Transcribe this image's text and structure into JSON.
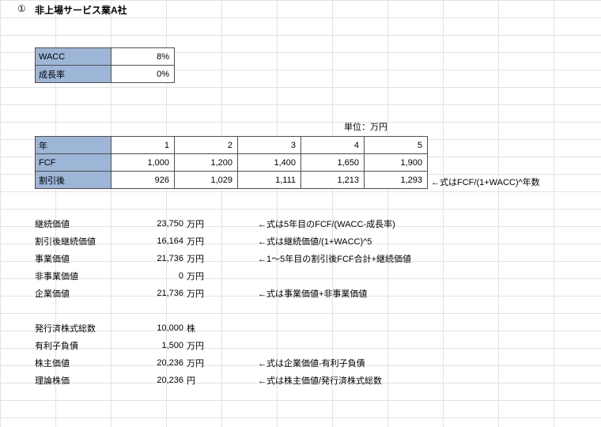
{
  "header": {
    "marker": "①",
    "title": "非上場サービス業A社"
  },
  "assumptions": {
    "wacc_label": "WACC",
    "wacc_value": "8%",
    "growth_label": "成長率",
    "growth_value": "0%"
  },
  "units_label": "単位：万円",
  "projection": {
    "year_label": "年",
    "fcf_label": "FCF",
    "disc_label": "割引後",
    "years": [
      "1",
      "2",
      "3",
      "4",
      "5"
    ],
    "fcf": [
      "1,000",
      "1,200",
      "1,400",
      "1,650",
      "1,900"
    ],
    "disc": [
      "926",
      "1,029",
      "1,111",
      "1,213",
      "1,293"
    ],
    "disc_note": "←式はFCF/(1+WACC)^年数"
  },
  "summary": [
    {
      "label": "継続価値",
      "value": "23,750",
      "unit": "万円",
      "note": "←式は5年目のFCF/(WACC-成長率)"
    },
    {
      "label": "割引後継続価値",
      "value": "16,164",
      "unit": "万円",
      "note": "←式は継続価値/(1+WACC)^5"
    },
    {
      "label": "事業価値",
      "value": "21,736",
      "unit": "万円",
      "note": "←1〜5年目の割引後FCF合計+継続価値"
    },
    {
      "label": "非事業価値",
      "value": "0",
      "unit": "万円",
      "note": ""
    },
    {
      "label": "企業価値",
      "value": "21,736",
      "unit": "万円",
      "note": "←式は事業価値+非事業価値"
    },
    {
      "label": "",
      "value": "",
      "unit": "",
      "note": ""
    },
    {
      "label": "発行済株式総数",
      "value": "10,000",
      "unit": "株",
      "note": ""
    },
    {
      "label": "有利子負債",
      "value": "1,500",
      "unit": "万円",
      "note": ""
    },
    {
      "label": "株主価値",
      "value": "20,236",
      "unit": "万円",
      "note": "←式は企業価値-有利子負債"
    },
    {
      "label": "理論株価",
      "value": "20,236",
      "unit": "円",
      "note": "←式は株主価値/発行済株式総数"
    }
  ],
  "chart_data": {
    "type": "table",
    "title": "非上場サービス業A社 DCF法による企業価値評価",
    "assumptions": {
      "WACC": 0.08,
      "成長率": 0.0
    },
    "unit": "万円",
    "years": [
      1,
      2,
      3,
      4,
      5
    ],
    "FCF": [
      1000,
      1200,
      1400,
      1650,
      1900
    ],
    "割引後FCF": [
      926,
      1029,
      1111,
      1213,
      1293
    ],
    "継続価値_万円": 23750,
    "割引後継続価値_万円": 16164,
    "事業価値_万円": 21736,
    "非事業価値_万円": 0,
    "企業価値_万円": 21736,
    "発行済株式総数_株": 10000,
    "有利子負債_万円": 1500,
    "株主価値_万円": 20236,
    "理論株価_円": 20236
  }
}
